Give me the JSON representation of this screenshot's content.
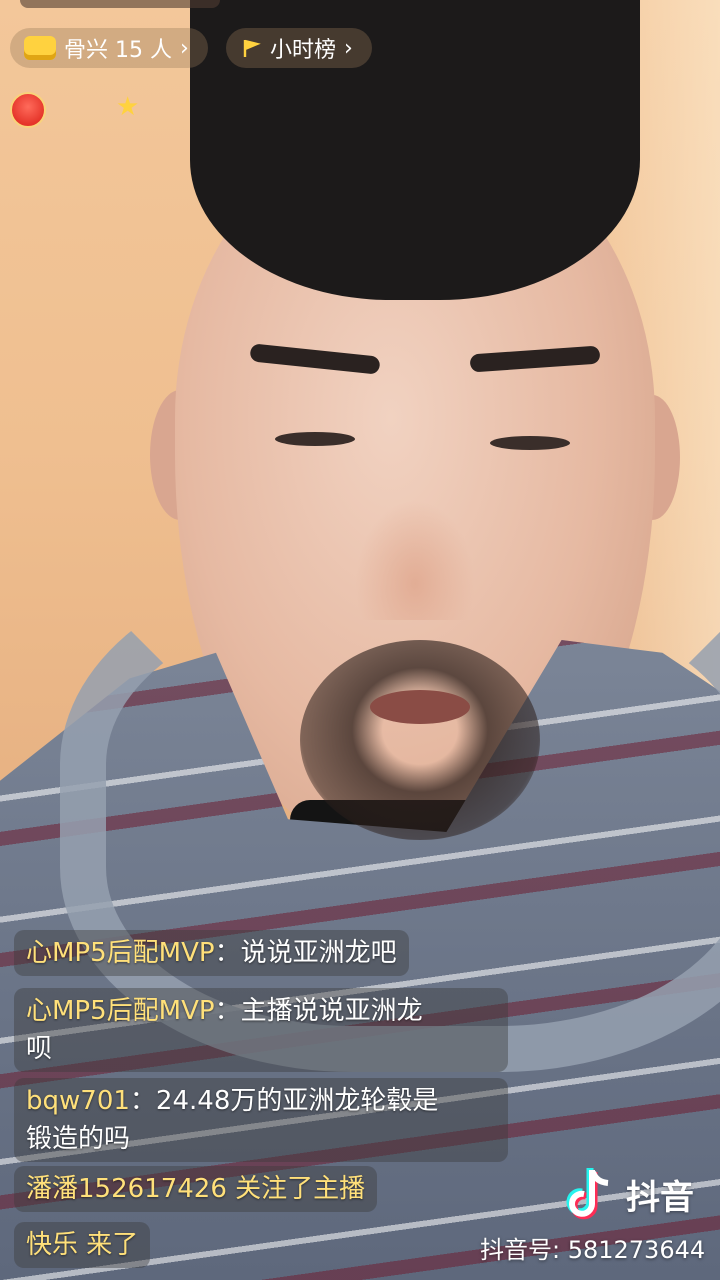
{
  "top": {
    "fans_pill": {
      "icon": "crown-icon",
      "label": "骨兴 15 人"
    },
    "hour_rank_pill": {
      "icon": "flag-icon",
      "label": "小时榜"
    }
  },
  "chat": [
    {
      "user": "心MP5后配MVP",
      "text": "说说亚洲龙吧"
    },
    {
      "user": "心MP5后配MVP",
      "text": "主播说说亚洲龙",
      "text_cont": "呗"
    },
    {
      "user": "bqw701",
      "text": "24.48万的亚洲龙轮毂是",
      "text_cont": "锻造的吗"
    },
    {
      "user": "潘潘152617426",
      "text": "关注了主播"
    },
    {
      "user": "快乐",
      "text": "来了"
    }
  ],
  "watermark": {
    "logo_text": "抖音",
    "douyin_id": "抖音号: 581273644"
  },
  "colors": {
    "username": "#ffe07a",
    "bubble": "rgba(60,60,60,0.42)",
    "crown": "#ffd23f"
  }
}
